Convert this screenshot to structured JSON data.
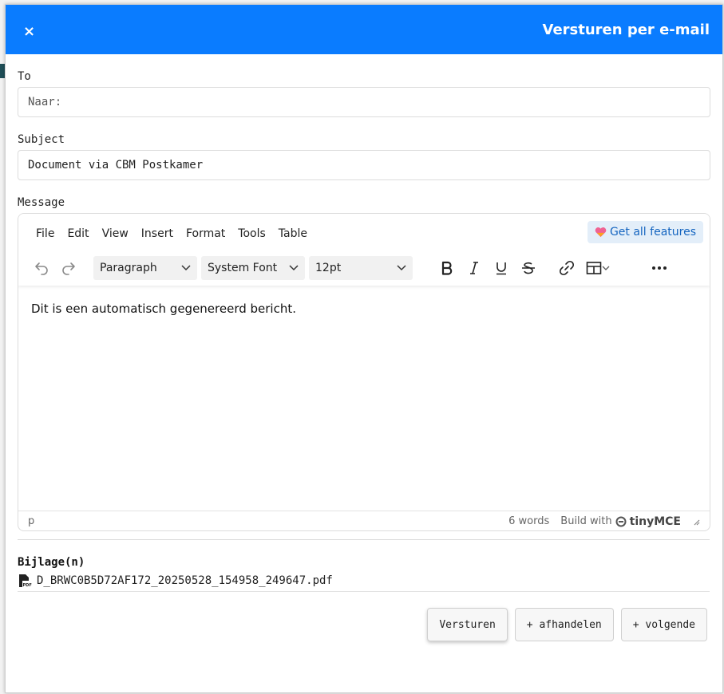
{
  "dialog": {
    "title": "Versturen per e-mail",
    "close_glyph": "×"
  },
  "to": {
    "label": "To",
    "value": "",
    "placeholder": "Naar:"
  },
  "subject": {
    "label": "Subject",
    "value": "Document via CBM Postkamer"
  },
  "message": {
    "label": "Message",
    "menu": [
      "File",
      "Edit",
      "View",
      "Insert",
      "Format",
      "Tools",
      "Table"
    ],
    "get_features": "Get all features",
    "block_format": "Paragraph",
    "font_family": "System Font",
    "font_size": "12pt",
    "content": "Dit is een automatisch gegenereerd bericht.",
    "status_path": "p",
    "word_count": "6 words",
    "build_with": "Build with",
    "brand": "tinyMCE"
  },
  "attachments": {
    "label": "Bijlage(n)",
    "files": [
      "D_BRWC0B5D72AF172_20250528_154958_249647.pdf"
    ]
  },
  "actions": {
    "send": "Versturen",
    "handle": "+ afhandelen",
    "next": "+ volgende"
  },
  "colors": {
    "header": "#0a7cff",
    "accent": "#1565c0"
  },
  "icons": [
    "close-icon",
    "undo-icon",
    "redo-icon",
    "chevron-down-icon",
    "bold-icon",
    "italic-icon",
    "underline-icon",
    "strikethrough-icon",
    "link-icon",
    "table-icon",
    "more-icon",
    "heart-icon",
    "pdf-icon",
    "resize-icon"
  ]
}
